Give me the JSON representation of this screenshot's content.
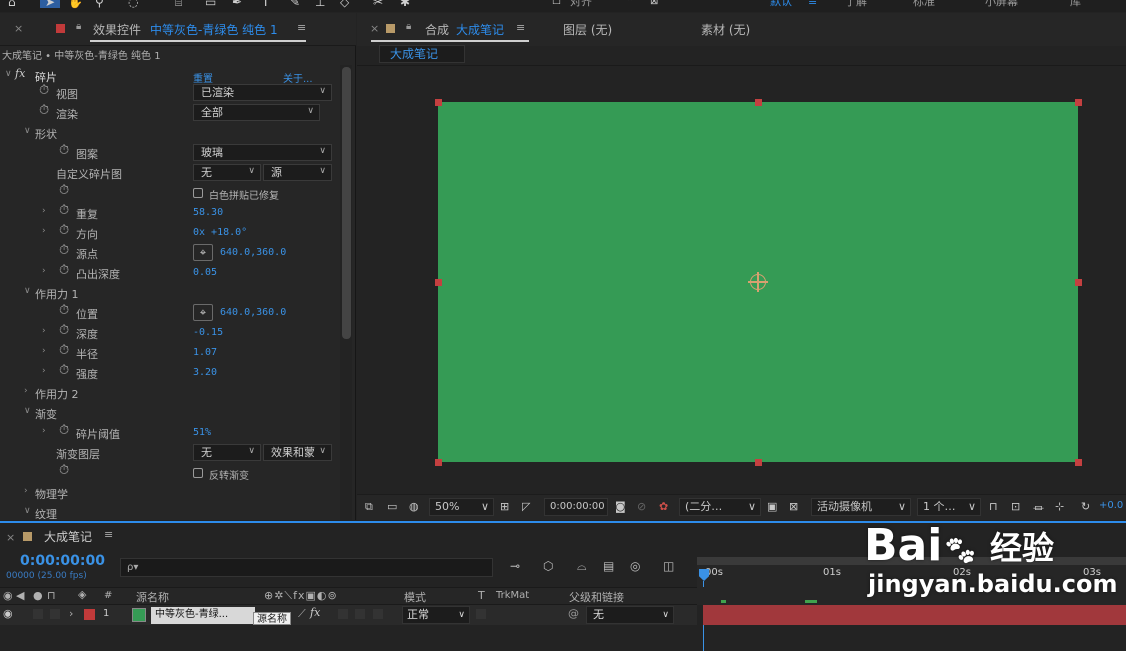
{
  "topbar": {
    "tools": [
      "home-icon",
      "selection-arrow-icon",
      "hand-icon",
      "zoom-icon",
      "rotate-icon",
      "camera-icon",
      "rectangle-icon",
      "pen-icon",
      "text-icon",
      "brush-icon",
      "stamp-icon",
      "eraser-icon",
      "roto-icon",
      "puppet-icon"
    ],
    "snap_label": "对齐",
    "workspaces": [
      "默认",
      "≡",
      "了解",
      "标准",
      "小屏幕",
      "库"
    ]
  },
  "effects_panel": {
    "tab_prefix": "效果控件",
    "tab_layer": "中等灰色-青绿色 纯色 1",
    "breadcrumb": "大成笔记 • 中等灰色-青绿色 纯色 1",
    "effect": {
      "fx": "fx",
      "name": "碎片",
      "reset": "重置",
      "about": "关于..."
    },
    "rows": {
      "view": {
        "label": "视图",
        "value": "已渲染"
      },
      "render": {
        "label": "渲染",
        "value": "全部"
      },
      "shape": {
        "label": "形状"
      },
      "pattern": {
        "label": "图案",
        "value": "玻璃"
      },
      "custom_map": {
        "label": "自定义碎片图",
        "value": "无",
        "value2": "源"
      },
      "white_tiles": {
        "label": "白色拼贴已修复"
      },
      "repetitions": {
        "label": "重复",
        "value": "58.30"
      },
      "direction": {
        "label": "方向",
        "value": "0x +18.0°"
      },
      "origin": {
        "label": "源点",
        "value": "640.0,360.0"
      },
      "extrusion": {
        "label": "凸出深度",
        "value": "0.05"
      },
      "force1": {
        "label": "作用力 1"
      },
      "position": {
        "label": "位置",
        "value": "640.0,360.0"
      },
      "depth": {
        "label": "深度",
        "value": "-0.15"
      },
      "radius": {
        "label": "半径",
        "value": "1.07"
      },
      "strength": {
        "label": "强度",
        "value": "3.20"
      },
      "force2": {
        "label": "作用力 2"
      },
      "gradient": {
        "label": "渐变"
      },
      "threshold": {
        "label": "碎片阈值",
        "value": "51%"
      },
      "grad_layer": {
        "label": "渐变图层",
        "value": "无",
        "value2": "效果和蒙"
      },
      "invert": {
        "label": "反转渐变"
      },
      "physics": {
        "label": "物理学"
      },
      "texture": {
        "label": "纹理"
      }
    }
  },
  "comp_panel": {
    "tab_prefix": "合成",
    "tab_name": "大成笔记",
    "layer_tab": "图层 (无)",
    "footage_tab": "素材 (无)",
    "subtab": "大成笔记",
    "solid_color": "#359b55"
  },
  "viewer_bar": {
    "zoom": "50%",
    "timecode": "0:00:00:00",
    "resolution": "(二分…",
    "camera": "活动摄像机",
    "views": "1 个…",
    "exposure": "+0.0"
  },
  "timeline": {
    "tab": "大成笔记",
    "timecode": "0:00:00:00",
    "frame_info": "00000 (25.00 fps)",
    "search_placeholder": "ρ▾",
    "col_num": "#",
    "col_source": "源名称",
    "col_mode": "模式",
    "col_t": "T",
    "col_trkmat": "TrkMat",
    "col_parent": "父级和链接",
    "ruler_ticks": [
      "00s",
      "01s",
      "02s",
      "03s"
    ],
    "layer": {
      "number": "1",
      "name": "中等灰色-青绿...",
      "tooltip": "源名称",
      "mode": "正常",
      "parent": "无",
      "label_color": "#c13a3a",
      "bar_color": "#a1383c"
    }
  },
  "watermark": {
    "logo": "Bai",
    "logo2": "经验",
    "url": "jingyan.baidu.com"
  }
}
